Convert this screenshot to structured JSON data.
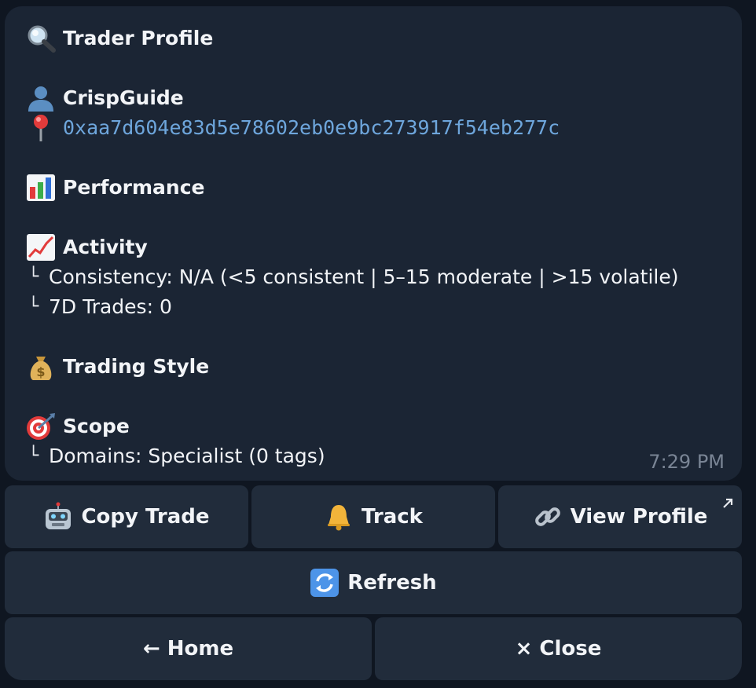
{
  "message": {
    "title": "Trader Profile",
    "username": "CrispGuide",
    "address": "0xaa7d604e83d5e78602eb0e9bc273917f54eb277c",
    "performance_heading": "Performance",
    "activity_heading": "Activity",
    "activity_lines": [
      "Consistency: N/A (<5 consistent | 5–15 moderate | >15 volatile)",
      "7D Trades: 0"
    ],
    "trading_style_heading": "Trading Style",
    "scope_heading": "Scope",
    "scope_lines": [
      "Domains: Specialist (0 tags)"
    ],
    "tree_glyph": "└",
    "timestamp": "7:29 PM"
  },
  "buttons": {
    "copy_trade": "Copy Trade",
    "track": "Track",
    "view_profile": "View Profile",
    "refresh": "Refresh",
    "home": "← Home",
    "close": "× Close"
  },
  "icons": {
    "title": "magnifier-icon",
    "user": "bust-silhouette-icon",
    "address": "round-pushpin-icon",
    "performance": "bar-chart-icon",
    "activity": "chart-increasing-icon",
    "trading_style": "money-bag-icon",
    "scope": "direct-hit-icon",
    "copy_trade": "robot-icon",
    "track": "bell-icon",
    "view_profile": "link-icon",
    "refresh": "refresh-arrows-icon",
    "external": "external-arrow-icon"
  },
  "colors": {
    "background": "#0f1621",
    "bubble": "#1b2534",
    "button": "#212c3b",
    "link": "#6ea6dc",
    "timestamp": "#7a8595"
  }
}
